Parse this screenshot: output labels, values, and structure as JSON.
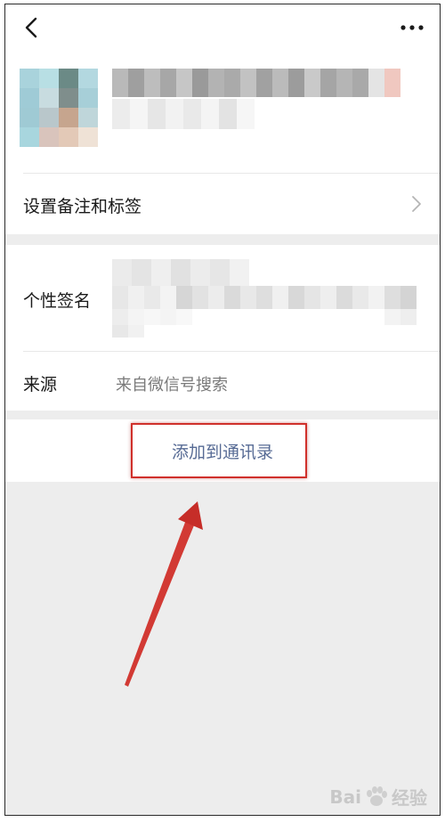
{
  "header": {
    "back_icon": "chevron-left-icon",
    "more_icon": "more-dots-icon"
  },
  "rows": {
    "remark_tags_label": "设置备注和标签",
    "signature_label": "个性签名",
    "source_label": "来源",
    "source_value": "来自微信号搜索"
  },
  "actions": {
    "add_to_contacts": "添加到通讯录"
  },
  "watermark": {
    "brand": "Bai",
    "suffix": "经验"
  },
  "colors": {
    "link_blue": "#576b95",
    "annotation_red": "#d0302b",
    "page_bg": "#ededed"
  }
}
